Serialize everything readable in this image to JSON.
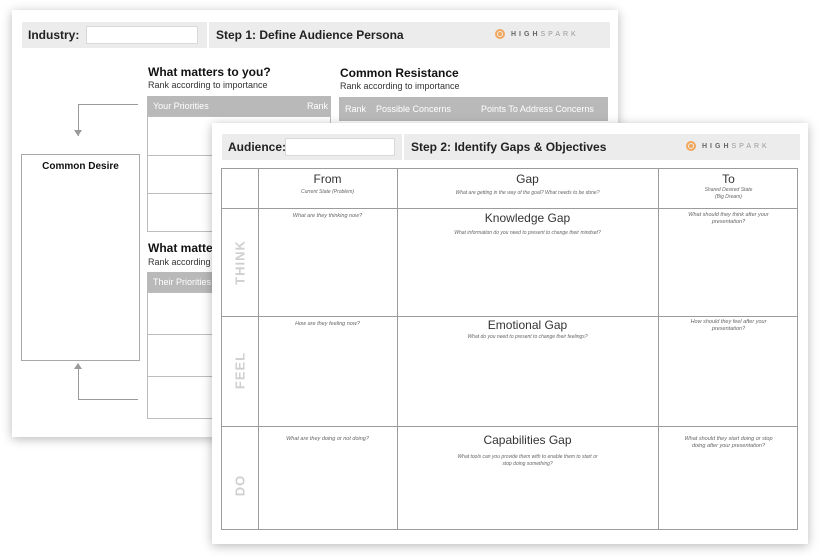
{
  "back_sheet": {
    "industry_label": "Industry:",
    "step_title": "Step 1: Define Audience Persona",
    "logo": {
      "brand_a": "HIGH",
      "brand_b": "SPARK",
      "accent": "#f2a65a"
    },
    "what_matters": {
      "title": "What matters to you?",
      "subtitle": "Rank according to importance",
      "col_priorities": "Your Priorities",
      "col_rank": "Rank"
    },
    "common_resistance": {
      "title": "Common Resistance",
      "subtitle": "Rank according to importance",
      "col_rank": "Rank",
      "col_concerns": "Possible Concerns",
      "col_points": "Points To Address Concerns"
    },
    "what_matters_them": {
      "title": "What matter",
      "subtitle": "Rank according t",
      "col_priorities": "Their Priorities"
    },
    "common_desire": "Common Desire"
  },
  "front_sheet": {
    "audience_label": "Audience:",
    "step_title": "Step 2: Identify Gaps & Objectives",
    "logo": {
      "brand_a": "HIGH",
      "brand_b": "SPARK"
    },
    "columns": {
      "from": {
        "title": "From",
        "sub": "Current State (Problem)"
      },
      "gap": {
        "title": "Gap",
        "sub": "What are getting in the way of the goal? What needs to be done?"
      },
      "to": {
        "title": "To",
        "sub_line1": "Shared Desired State",
        "sub_line2": "(Big Dream)"
      }
    },
    "rows": [
      {
        "label": "THINK",
        "from_prompt": "What are they thinking now?",
        "gap_title": "Knowledge Gap",
        "gap_prompt": "What information do you need to present to change their mindset?",
        "to_prompt_line1": "What should they think after your",
        "to_prompt_line2": "presentation?"
      },
      {
        "label": "FEEL",
        "from_prompt": "How are they feeling now?",
        "gap_title": "Emotional Gap",
        "gap_prompt": "What do you need to present to change their feelings?",
        "to_prompt_line1": "How should they feel after your",
        "to_prompt_line2": "presentation?"
      },
      {
        "label": "DO",
        "from_prompt": "What are they doing or not doing?",
        "gap_title": "Capabilities Gap",
        "gap_prompt_line1": "What tools can you provide them with to enable them to start or",
        "gap_prompt_line2": "stop doing something?",
        "to_prompt_line1": "What should they start doing or stop",
        "to_prompt_line2": "doing after your presentation?"
      }
    ]
  }
}
